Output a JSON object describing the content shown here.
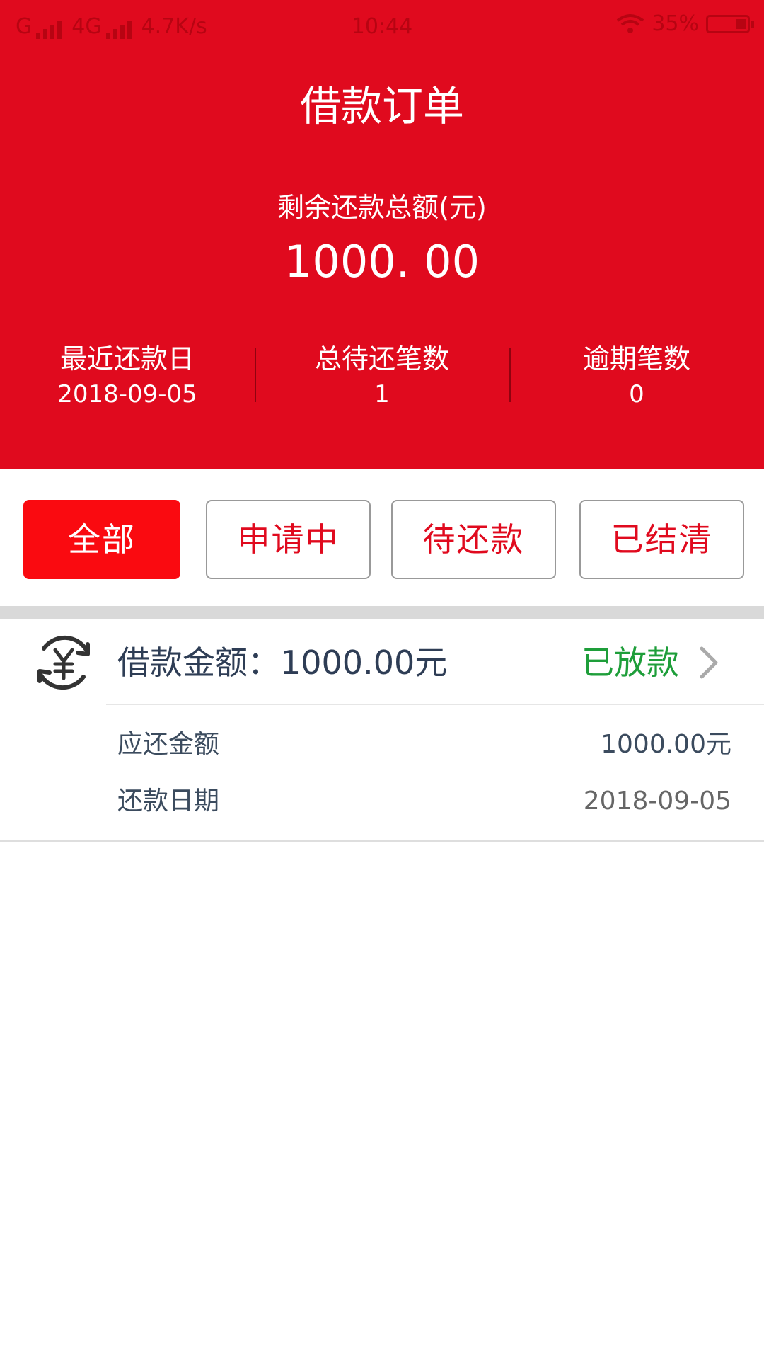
{
  "status_bar": {
    "carrier1": "G",
    "network": "4G",
    "speed": "4.7K/s",
    "time": "10:44",
    "battery": "35%"
  },
  "header": {
    "title": "借款订单",
    "remaining_label": "剩余还款总额(元)",
    "remaining_amount": "1000. 00",
    "stats": [
      {
        "label": "最近还款日",
        "value": "2018-09-05"
      },
      {
        "label": "总待还笔数",
        "value": "1"
      },
      {
        "label": "逾期笔数",
        "value": "0"
      }
    ]
  },
  "tabs": [
    {
      "label": "全部",
      "active": true
    },
    {
      "label": "申请中",
      "active": false
    },
    {
      "label": "待还款",
      "active": false
    },
    {
      "label": "已结清",
      "active": false
    }
  ],
  "order": {
    "icon": "yuan-refresh-icon",
    "title": "借款金额：1000.00元",
    "status": "已放款",
    "rows": [
      {
        "label": "应还金额",
        "value": "1000.00元"
      },
      {
        "label": "还款日期",
        "value": "2018-09-05"
      }
    ]
  },
  "colors": {
    "header_bg": "#e00a1e",
    "active_tab": "#fa0a10",
    "status_green": "#1e9e3a",
    "text_dark": "#2e3d55"
  }
}
